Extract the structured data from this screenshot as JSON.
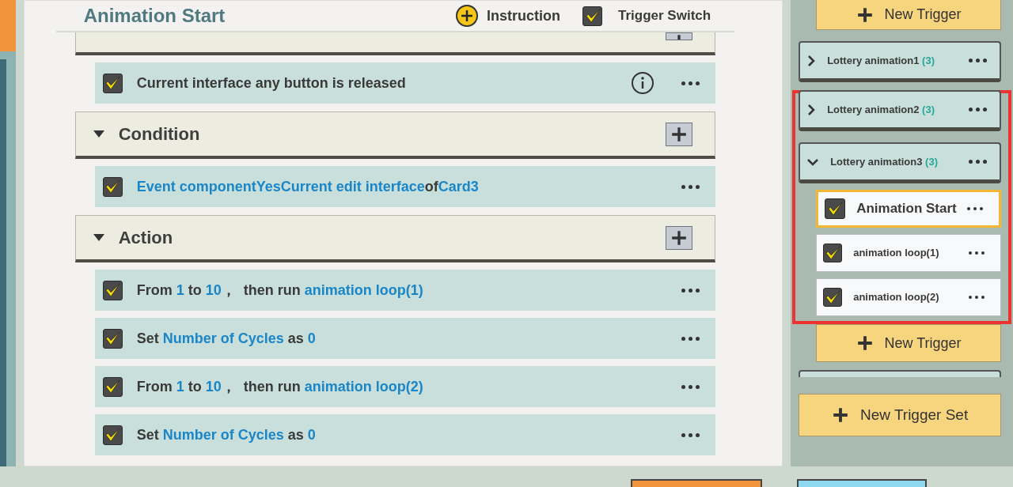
{
  "header": {
    "title": "Animation Start",
    "instruction": "Instruction",
    "trigger_switch": {
      "label": "Trigger Switch",
      "checked": true
    }
  },
  "sections": [
    {
      "rows": [
        {
          "checked": true,
          "info": true,
          "segments": [
            {
              "text": "Current interface any button is released",
              "kind": "plain"
            }
          ]
        }
      ]
    },
    {
      "title": "Condition",
      "expanded": true,
      "rows": [
        {
          "checked": true,
          "info": false,
          "segments": [
            {
              "text": "Event componentYesCurrent edit interface",
              "kind": "value"
            },
            {
              "text": "of",
              "kind": "plain"
            },
            {
              "text": "Card3",
              "kind": "value"
            }
          ]
        }
      ]
    },
    {
      "title": "Action",
      "expanded": true,
      "rows": [
        {
          "checked": true,
          "info": false,
          "segments": [
            {
              "text": "From ",
              "kind": "plain"
            },
            {
              "text": "1",
              "kind": "value"
            },
            {
              "text": " to ",
              "kind": "plain"
            },
            {
              "text": "10",
              "kind": "value"
            },
            {
              "text": "，  then run ",
              "kind": "plain"
            },
            {
              "text": "animation loop(1)",
              "kind": "value"
            }
          ]
        },
        {
          "checked": true,
          "info": false,
          "segments": [
            {
              "text": "Set ",
              "kind": "plain"
            },
            {
              "text": "Number of Cycles",
              "kind": "value"
            },
            {
              "text": " as ",
              "kind": "plain"
            },
            {
              "text": "0",
              "kind": "value"
            }
          ]
        },
        {
          "checked": true,
          "info": false,
          "segments": [
            {
              "text": "From ",
              "kind": "plain"
            },
            {
              "text": "1",
              "kind": "value"
            },
            {
              "text": " to ",
              "kind": "plain"
            },
            {
              "text": "10",
              "kind": "value"
            },
            {
              "text": "，  then run ",
              "kind": "plain"
            },
            {
              "text": "animation loop(2)",
              "kind": "value"
            }
          ]
        },
        {
          "checked": true,
          "info": false,
          "segments": [
            {
              "text": "Set ",
              "kind": "plain"
            },
            {
              "text": "Number of Cycles",
              "kind": "value"
            },
            {
              "text": " as ",
              "kind": "plain"
            },
            {
              "text": "0",
              "kind": "value"
            }
          ]
        }
      ]
    }
  ],
  "sidebar": {
    "new_trigger_top": "New Trigger",
    "groups": [
      {
        "name": "Lottery animation1",
        "count": "(3)",
        "expanded": false,
        "highlighted": false
      },
      {
        "name": "Lottery animation2",
        "count": "(3)",
        "expanded": false,
        "highlighted": true
      },
      {
        "name": "Lottery animation3",
        "count": "(3)",
        "expanded": true,
        "highlighted": true,
        "triggers": [
          {
            "name": "Animation Start",
            "checked": true,
            "selected": true
          },
          {
            "name": "animation loop(1)",
            "checked": true,
            "selected": false
          },
          {
            "name": "animation loop(2)",
            "checked": true,
            "selected": false
          }
        ],
        "new_trigger": "New Trigger"
      }
    ],
    "new_trigger_set": "New Trigger Set"
  }
}
